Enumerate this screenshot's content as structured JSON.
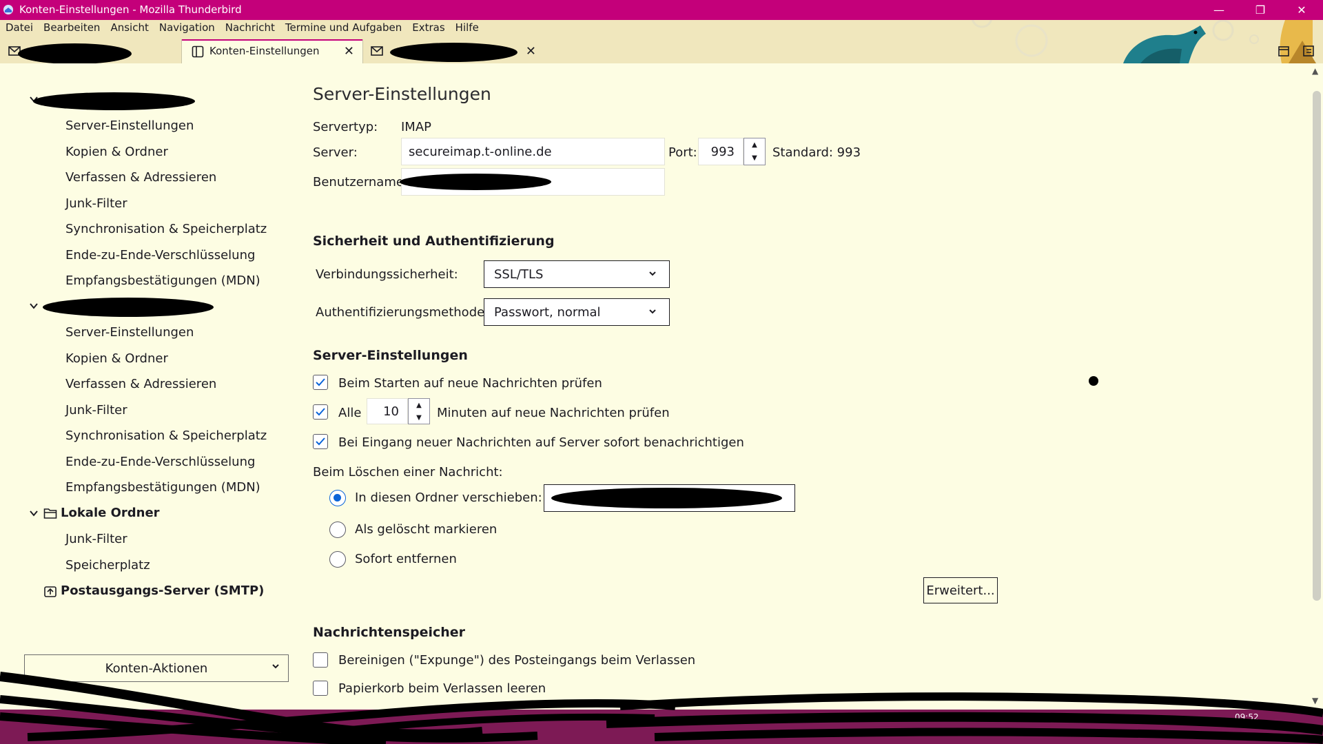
{
  "window": {
    "title": "Konten-Einstellungen - Mozilla Thunderbird",
    "controls": [
      "minimize",
      "restore",
      "close"
    ]
  },
  "menubar": {
    "items": [
      "Datei",
      "Bearbeiten",
      "Ansicht",
      "Navigation",
      "Nachricht",
      "Termine und Aufgaben",
      "Extras",
      "Hilfe"
    ]
  },
  "tabs": [
    {
      "label": "",
      "icon": "mail-icon"
    },
    {
      "label": "Konten-Einstellungen",
      "icon": "account-settings-icon",
      "active": true
    },
    {
      "label": "",
      "icon": "mail-icon"
    }
  ],
  "sidebar": {
    "account1": {
      "items": [
        "Server-Einstellungen",
        "Kopien & Ordner",
        "Verfassen & Adressieren",
        "Junk-Filter",
        "Synchronisation & Speicherplatz",
        "Ende-zu-Ende-Verschlüsselung",
        "Empfangsbestätigungen (MDN)"
      ]
    },
    "account2": {
      "items": [
        "Server-Einstellungen",
        "Kopien & Ordner",
        "Verfassen & Adressieren",
        "Junk-Filter",
        "Synchronisation & Speicherplatz",
        "Ende-zu-Ende-Verschlüsselung",
        "Empfangsbestätigungen (MDN)"
      ]
    },
    "local_folders": {
      "label": "Lokale Ordner",
      "items": [
        "Junk-Filter",
        "Speicherplatz"
      ]
    },
    "smtp": {
      "label": "Postausgangs-Server (SMTP)"
    },
    "account_actions": "Konten-Aktionen"
  },
  "main": {
    "title": "Server-Einstellungen",
    "server_type_label": "Servertyp:",
    "server_type_value": "IMAP",
    "server_label": "Server:",
    "server_value": "secureimap.t-online.de",
    "port_label": "Port:",
    "port_value": "993",
    "port_default": "Standard: 993",
    "username_label": "Benutzername:",
    "security": {
      "heading": "Sicherheit und Authentifizierung",
      "connection_label": "Verbindungssicherheit:",
      "connection_value": "SSL/TLS",
      "auth_label": "Authentifizierungsmethode:",
      "auth_value": "Passwort, normal"
    },
    "server_settings": {
      "heading": "Server-Einstellungen",
      "check_on_start": {
        "label": "Beim Starten auf neue Nachrichten prüfen",
        "checked": true
      },
      "check_every": {
        "label_pre": "Alle",
        "value": "10",
        "label_post": "Minuten auf neue Nachrichten prüfen",
        "checked": true
      },
      "notify": {
        "label": "Bei Eingang neuer Nachrichten auf Server sofort benachrichtigen",
        "checked": true
      },
      "on_delete_label": "Beim Löschen einer Nachricht:",
      "radio_move": {
        "label": "In diesen Ordner verschieben:",
        "selected": true
      },
      "radio_mark": {
        "label": "Als gelöscht markieren",
        "selected": false
      },
      "radio_remove": {
        "label": "Sofort entfernen",
        "selected": false
      },
      "advanced_button": "Erweitert..."
    },
    "storage": {
      "heading": "Nachrichtenspeicher",
      "expunge": {
        "label": "Bereinigen (\"Expunge\") des Posteingangs beim Verlassen",
        "checked": false
      },
      "empty_trash": {
        "label": "Papierkorb beim Verlassen leeren",
        "checked": false
      }
    }
  },
  "taskbar": {
    "time": "09:52"
  },
  "colors": {
    "titlebar": "#c4007a",
    "background": "#fdfde3",
    "accent": "#0a64d8"
  }
}
